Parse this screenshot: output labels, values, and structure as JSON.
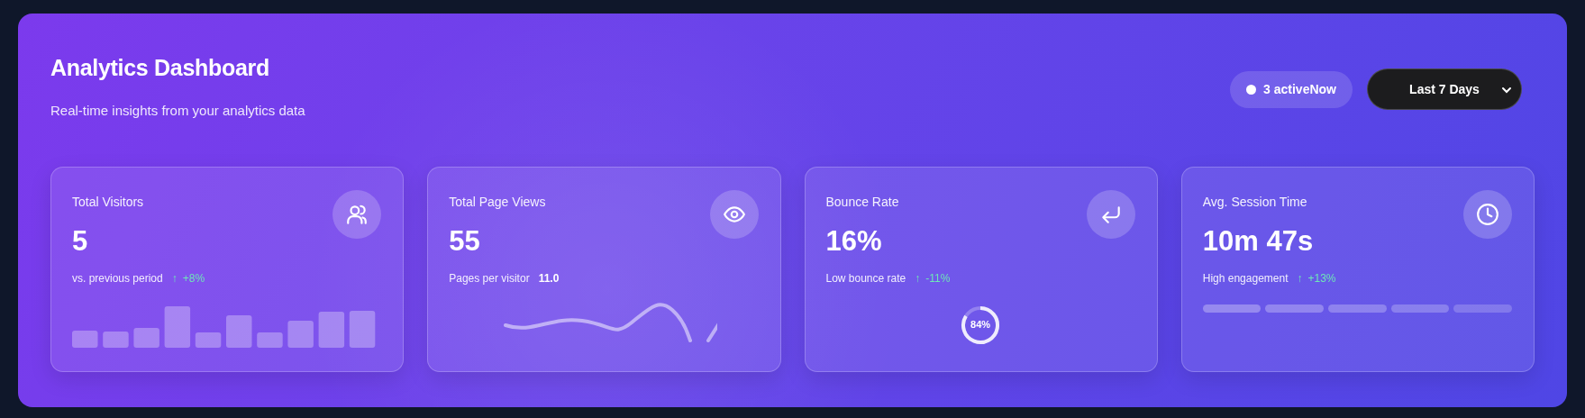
{
  "header": {
    "title": "Analytics Dashboard",
    "subtitle": "Real-time insights from your analytics data"
  },
  "active_badge": {
    "label": "3 activeNow"
  },
  "range_select": {
    "value": "Last 7 Days"
  },
  "cards": [
    {
      "kind": "bars",
      "title": "Total Visitors",
      "value": "5",
      "note": "vs. previous period",
      "trend_arrow": "↑",
      "change": "+8%"
    },
    {
      "kind": "wave",
      "title": "Total Page Views",
      "value": "55",
      "note": "Pages per visitor",
      "detail": "11.0"
    },
    {
      "kind": "ring",
      "title": "Bounce Rate",
      "value": "16%",
      "note": "Low bounce rate",
      "trend_arrow": "↑",
      "change": "-11%",
      "ring": {
        "label": "84%",
        "level": 0.84
      }
    },
    {
      "kind": "segments",
      "title": "Avg. Session Time",
      "value": "10m 47s",
      "note": "High engagement",
      "trend_arrow": "↑",
      "change": "+13%"
    }
  ]
}
